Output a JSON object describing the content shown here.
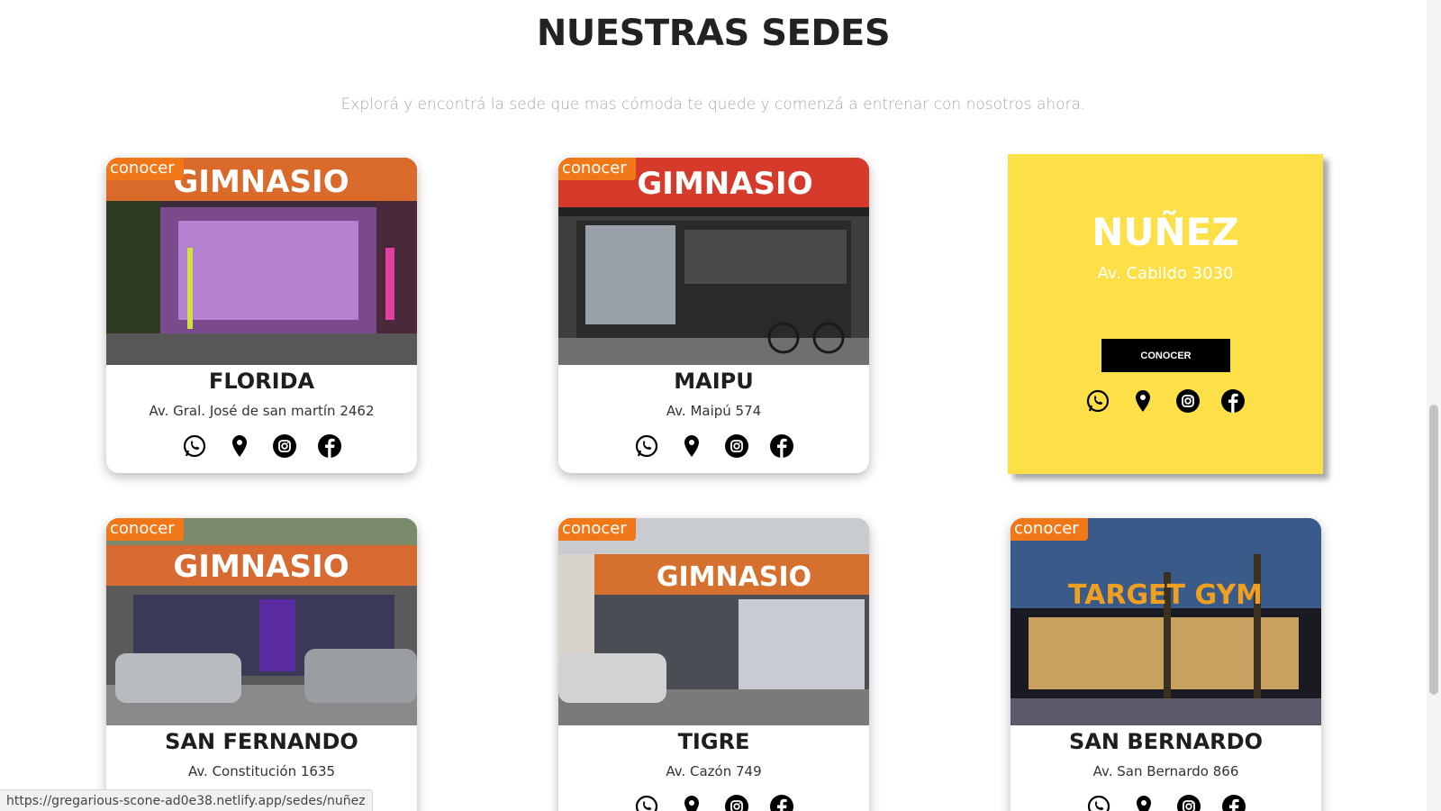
{
  "header": {
    "title": "NUESTRAS SEDES",
    "subtitle": "Explorá y encontrá la sede que mas cómoda te quede y comenzá a entrenar con nosotros ahora."
  },
  "card_tag": "conocer",
  "cards": [
    {
      "name": "FLORIDA",
      "address": "Av. Gral. José de san martín 2462",
      "photo_sign": "GIMNASIO"
    },
    {
      "name": "MAIPU",
      "address": "Av. Maipú 574",
      "photo_sign": "GIMNASIO"
    },
    {
      "name": "SAN FERNANDO",
      "address": "Av. Constitución 1635",
      "photo_sign": "GIMNASIO"
    },
    {
      "name": "TIGRE",
      "address": "Av. Cazón 749",
      "photo_sign": "GIMNASIO"
    },
    {
      "name": "SAN BERNARDO",
      "address": "Av. San Bernardo 866",
      "photo_sign": "TARGET GYM"
    }
  ],
  "featured": {
    "name": "NUÑEZ",
    "address": "Av. Cabildo 3030",
    "button_label": "CONOCER"
  },
  "icons": [
    "whatsapp-icon",
    "map-pin-icon",
    "instagram-icon",
    "facebook-icon"
  ],
  "status_url": "https://gregarious-scone-ad0e38.netlify.app/sedes/nuñez",
  "colors": {
    "accent_orange": "#f07818",
    "featured_yellow": "#fde047",
    "title_text": "#222222",
    "subtitle_text": "#a8a8a8"
  }
}
